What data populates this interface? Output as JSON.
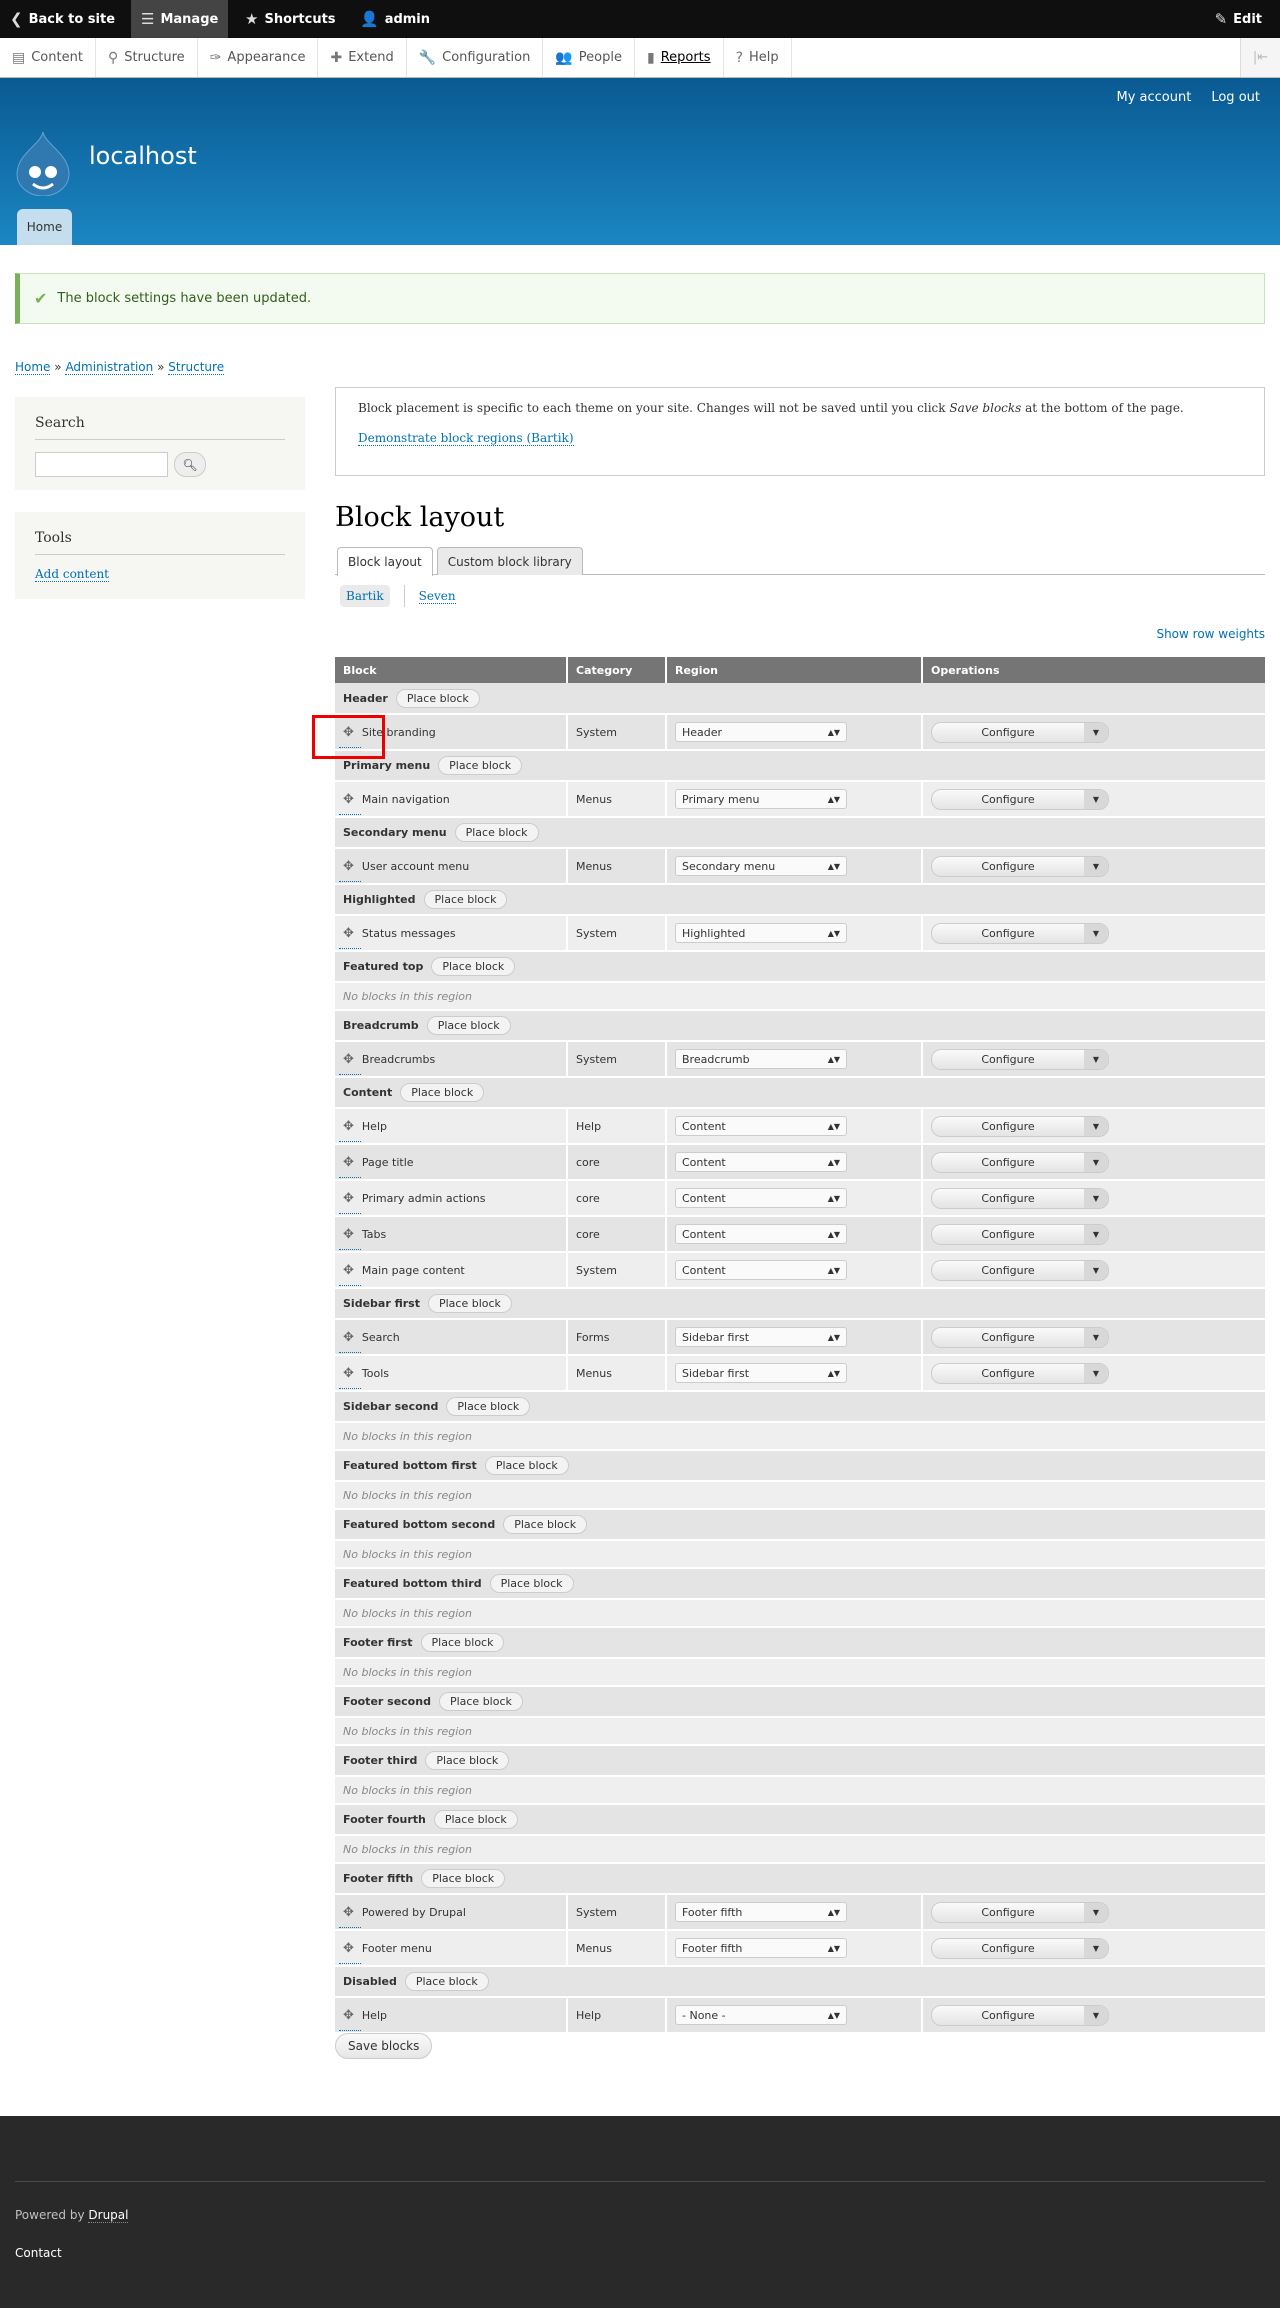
{
  "toolbar": {
    "back": "Back to site",
    "manage": "Manage",
    "shortcuts": "Shortcuts",
    "user": "admin",
    "edit": "Edit"
  },
  "tray": [
    "Content",
    "Structure",
    "Appearance",
    "Extend",
    "Configuration",
    "People",
    "Reports",
    "Help"
  ],
  "header": {
    "my_account": "My account",
    "log_out": "Log out",
    "site_name": "localhost",
    "home_tab": "Home"
  },
  "message": "The block settings have been updated.",
  "breadcrumb": {
    "home": "Home",
    "sep": "»",
    "admin": "Administration",
    "structure": "Structure"
  },
  "sidebar": {
    "search_title": "Search",
    "tools_title": "Tools",
    "add_content": "Add content"
  },
  "help": {
    "text_before": "Block placement is specific to each theme on your site. Changes will not be saved until you click ",
    "em": "Save blocks",
    "text_after": " at the bottom of the page.",
    "demo_link": "Demonstrate block regions (Bartik)"
  },
  "page_title": "Block layout",
  "tabs": [
    "Block layout",
    "Custom block library"
  ],
  "themes": [
    "Bartik",
    "Seven"
  ],
  "show_row_weights": "Show row weights",
  "table": {
    "headers": [
      "Block",
      "Category",
      "Region",
      "Operations"
    ],
    "place_block": "Place block",
    "configure": "Configure",
    "empty": "No blocks in this region",
    "regions": [
      {
        "name": "Header",
        "blocks": [
          [
            "Site branding",
            "System",
            "Header"
          ]
        ]
      },
      {
        "name": "Primary menu",
        "blocks": [
          [
            "Main navigation",
            "Menus",
            "Primary menu"
          ]
        ]
      },
      {
        "name": "Secondary menu",
        "blocks": [
          [
            "User account menu",
            "Menus",
            "Secondary menu"
          ]
        ]
      },
      {
        "name": "Highlighted",
        "blocks": [
          [
            "Status messages",
            "System",
            "Highlighted"
          ]
        ]
      },
      {
        "name": "Featured top",
        "blocks": []
      },
      {
        "name": "Breadcrumb",
        "blocks": [
          [
            "Breadcrumbs",
            "System",
            "Breadcrumb"
          ]
        ]
      },
      {
        "name": "Content",
        "blocks": [
          [
            "Help",
            "Help",
            "Content"
          ],
          [
            "Page title",
            "core",
            "Content"
          ],
          [
            "Primary admin actions",
            "core",
            "Content"
          ],
          [
            "Tabs",
            "core",
            "Content"
          ],
          [
            "Main page content",
            "System",
            "Content"
          ]
        ]
      },
      {
        "name": "Sidebar first",
        "blocks": [
          [
            "Search",
            "Forms",
            "Sidebar first"
          ],
          [
            "Tools",
            "Menus",
            "Sidebar first"
          ]
        ]
      },
      {
        "name": "Sidebar second",
        "blocks": []
      },
      {
        "name": "Featured bottom first",
        "blocks": []
      },
      {
        "name": "Featured bottom second",
        "blocks": []
      },
      {
        "name": "Featured bottom third",
        "blocks": []
      },
      {
        "name": "Footer first",
        "blocks": []
      },
      {
        "name": "Footer second",
        "blocks": []
      },
      {
        "name": "Footer third",
        "blocks": []
      },
      {
        "name": "Footer fourth",
        "blocks": []
      },
      {
        "name": "Footer fifth",
        "blocks": [
          [
            "Powered by Drupal",
            "System",
            "Footer fifth"
          ],
          [
            "Footer menu",
            "Menus",
            "Footer fifth"
          ]
        ]
      },
      {
        "name": "Disabled",
        "blocks": [
          [
            "Help",
            "Help",
            "- None -"
          ]
        ]
      }
    ]
  },
  "save_blocks": "Save blocks",
  "footer": {
    "powered_by": "Powered by",
    "drupal": "Drupal",
    "contact": "Contact"
  },
  "colors": {
    "accent": "#0071b3",
    "header_top": "#0a5a92",
    "header_bottom": "#1b86c2",
    "success": "#77b259"
  }
}
